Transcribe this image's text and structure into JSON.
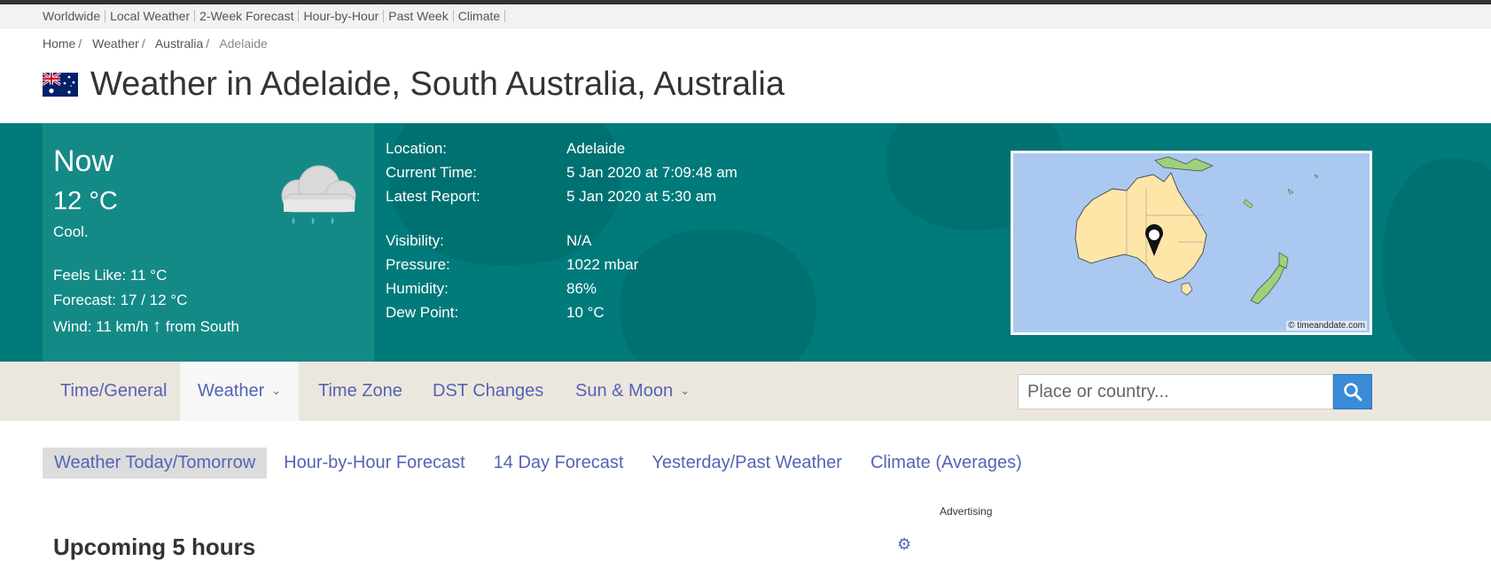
{
  "subnav": [
    "Worldwide",
    "Local Weather",
    "2-Week Forecast",
    "Hour-by-Hour",
    "Past Week",
    "Climate"
  ],
  "breadcrumb": {
    "home": "Home",
    "weather": "Weather",
    "country": "Australia",
    "current": "Adelaide",
    "sep": "/"
  },
  "page_title": "Weather in Adelaide, South Australia, Australia",
  "now": {
    "label": "Now",
    "temp": "12 °C",
    "desc": "Cool.",
    "feels_like": "Feels Like: 11 °C",
    "forecast": "Forecast: 17 / 12 °C",
    "wind_prefix": "Wind: 11 km/h",
    "wind_arrow": "↑",
    "wind_suffix": "from South"
  },
  "details": {
    "location_k": "Location:",
    "location_v": "Adelaide",
    "time_k": "Current Time:",
    "time_v": "5 Jan 2020 at 7:09:48 am",
    "report_k": "Latest Report:",
    "report_v": "5 Jan 2020 at 5:30 am",
    "visibility_k": "Visibility:",
    "visibility_v": "N/A",
    "pressure_k": "Pressure:",
    "pressure_v": "1022 mbar",
    "humidity_k": "Humidity:",
    "humidity_v": "86%",
    "dew_k": "Dew Point:",
    "dew_v": "10 °C"
  },
  "map_credit": "© timeanddate.com",
  "nav": {
    "time_general": "Time/General",
    "weather": "Weather",
    "time_zone": "Time Zone",
    "dst": "DST Changes",
    "sun_moon": "Sun & Moon",
    "chevron": "⌄"
  },
  "search": {
    "placeholder": "Place or country..."
  },
  "tabs": [
    "Weather Today/Tomorrow",
    "Hour-by-Hour Forecast",
    "14 Day Forecast",
    "Yesterday/Past Weather",
    "Climate (Averages)"
  ],
  "advertising": "Advertising",
  "upcoming": "Upcoming 5 hours",
  "icons": {
    "flag": "australia-flag-icon",
    "weather": "rain-cloud-icon",
    "search": "search-icon",
    "settings": "gear-icon"
  },
  "colors": {
    "hero": "#007a7a",
    "now_box": "#148a86",
    "link": "#5563b5",
    "nav_bg": "#ece7de",
    "search_btn": "#3a8bd8"
  }
}
